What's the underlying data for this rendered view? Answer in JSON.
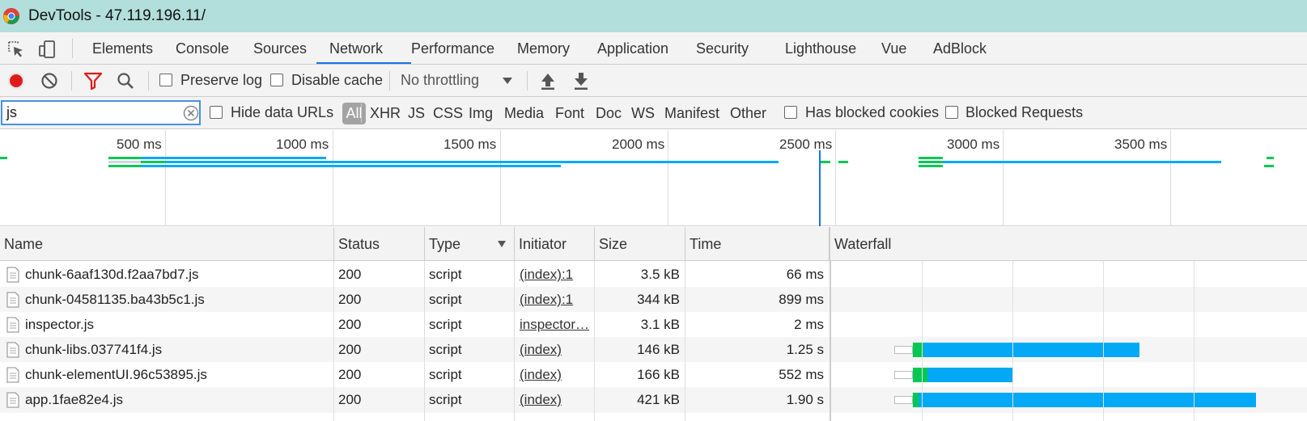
{
  "window": {
    "title": "DevTools - 47.119.196.11/"
  },
  "tabs": [
    {
      "label": "Elements"
    },
    {
      "label": "Console"
    },
    {
      "label": "Sources"
    },
    {
      "label": "Network"
    },
    {
      "label": "Performance"
    },
    {
      "label": "Memory"
    },
    {
      "label": "Application"
    },
    {
      "label": "Security"
    },
    {
      "label": "Lighthouse"
    },
    {
      "label": "Vue"
    },
    {
      "label": "AdBlock"
    }
  ],
  "active_tab": "Network",
  "toolbar": {
    "preserve_log": "Preserve log",
    "disable_cache": "Disable cache",
    "throttling": "No throttling",
    "record_color": "#e01b1b",
    "filter_color": "#e01b1b"
  },
  "filter": {
    "value": "js",
    "hide_data_urls": "Hide data URLs",
    "all": "All",
    "types": [
      "XHR",
      "JS",
      "CSS",
      "Img",
      "Media",
      "Font",
      "Doc",
      "WS",
      "Manifest",
      "Other"
    ],
    "has_blocked_cookies": "Has blocked cookies",
    "blocked_requests": "Blocked Requests"
  },
  "overview": {
    "labels": [
      "500 ms",
      "1000 ms",
      "1500 ms",
      "2000 ms",
      "2500 ms",
      "3000 ms",
      "3500 ms"
    ]
  },
  "columns": {
    "name": "Name",
    "status": "Status",
    "type": "Type",
    "initiator": "Initiator",
    "size": "Size",
    "time": "Time",
    "waterfall": "Waterfall"
  },
  "rows": [
    {
      "name": "chunk-6aaf130d.f2aa7bd7.js",
      "status": "200",
      "type": "script",
      "initiator": "(index):1",
      "size": "3.5 kB",
      "time": "66 ms"
    },
    {
      "name": "chunk-04581135.ba43b5c1.js",
      "status": "200",
      "type": "script",
      "initiator": "(index):1",
      "size": "344 kB",
      "time": "899 ms"
    },
    {
      "name": "inspector.js",
      "status": "200",
      "type": "script",
      "initiator": "inspector…",
      "size": "3.1 kB",
      "time": "2 ms"
    },
    {
      "name": "chunk-libs.037741f4.js",
      "status": "200",
      "type": "script",
      "initiator": "(index)",
      "size": "146 kB",
      "time": "1.25 s"
    },
    {
      "name": "chunk-elementUI.96c53895.js",
      "status": "200",
      "type": "script",
      "initiator": "(index)",
      "size": "166 kB",
      "time": "552 ms"
    },
    {
      "name": "app.1fae82e4.js",
      "status": "200",
      "type": "script",
      "initiator": "(index)",
      "size": "421 kB",
      "time": "1.90 s"
    }
  ],
  "colors": {
    "title_bar": "#b2dfdb",
    "waiting": "#00c853",
    "download": "#03a9f4",
    "accent": "#1a73e8"
  }
}
